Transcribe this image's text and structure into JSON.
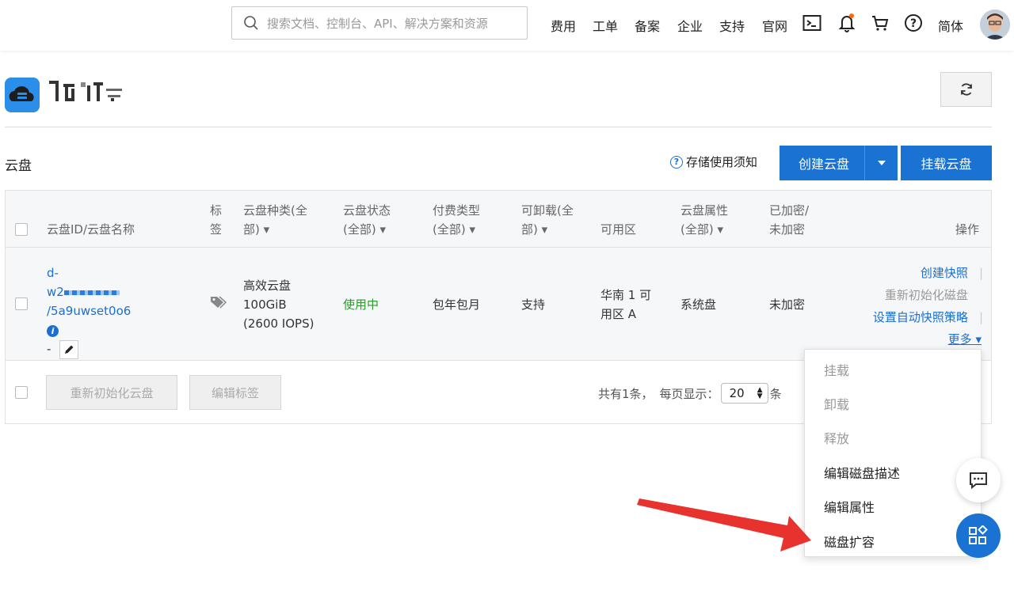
{
  "topbar": {
    "search_placeholder": "搜索文档、控制台、API、解决方案和资源",
    "nav": [
      "费用",
      "工单",
      "备案",
      "企业",
      "支持",
      "官网"
    ],
    "language": "简体",
    "icons": [
      "terminal-icon",
      "bell-icon",
      "cart-icon",
      "help-icon"
    ]
  },
  "page": {
    "section_title": "云盘",
    "notice": "存储使用须知",
    "create_button": "创建云盘",
    "attach_button": "挂载云盘"
  },
  "table": {
    "headers": {
      "id_name": "云盘ID/云盘名称",
      "tag": "标签",
      "type_1": "云盘种类(全",
      "type_2": "部)",
      "status_1": "云盘状态",
      "status_2": "(全部)",
      "billing_1": "付费类型",
      "billing_2": "(全部)",
      "detach_1": "可卸载(全",
      "detach_2": "部)",
      "zone": "可用区",
      "attr_1": "云盘属性",
      "attr_2": "(全部)",
      "enc_1": "已加密/",
      "enc_2": "未加密",
      "ops": "操作"
    },
    "row": {
      "id_prefix": "d-",
      "id_suffix": "w2",
      "id_tail": "/5a9uwset0o6",
      "name": "-",
      "type_1": "高效云盘",
      "type_2": "100GiB",
      "type_3": "(2600 IOPS)",
      "status": "使用中",
      "billing": "包年包月",
      "detach": "支持",
      "zone_1": "华南 1 可",
      "zone_2": "用区 A",
      "attr": "系统盘",
      "enc": "未加密",
      "ops": {
        "snapshot": "创建快照",
        "reinit": "重新初始化磁盘",
        "auto_snapshot": "设置自动快照策略",
        "more": "更多"
      }
    },
    "footer": {
      "reinit_button": "重新初始化云盘",
      "edit_tags_button": "编辑标签",
      "total": "共有1条，",
      "per_page_label": "每页显示：",
      "per_page_value": "20",
      "unit": "条"
    }
  },
  "more_menu": [
    {
      "label": "挂载",
      "enabled": false
    },
    {
      "label": "卸载",
      "enabled": false
    },
    {
      "label": "释放",
      "enabled": false
    },
    {
      "label": "编辑磁盘描述",
      "enabled": true
    },
    {
      "label": "编辑属性",
      "enabled": true
    },
    {
      "label": "磁盘扩容",
      "enabled": true
    }
  ],
  "colors": {
    "primary": "#1a72d2",
    "link": "#1c6ed0",
    "status_ok": "#2e9a2e",
    "arrow": "#e8322e"
  }
}
